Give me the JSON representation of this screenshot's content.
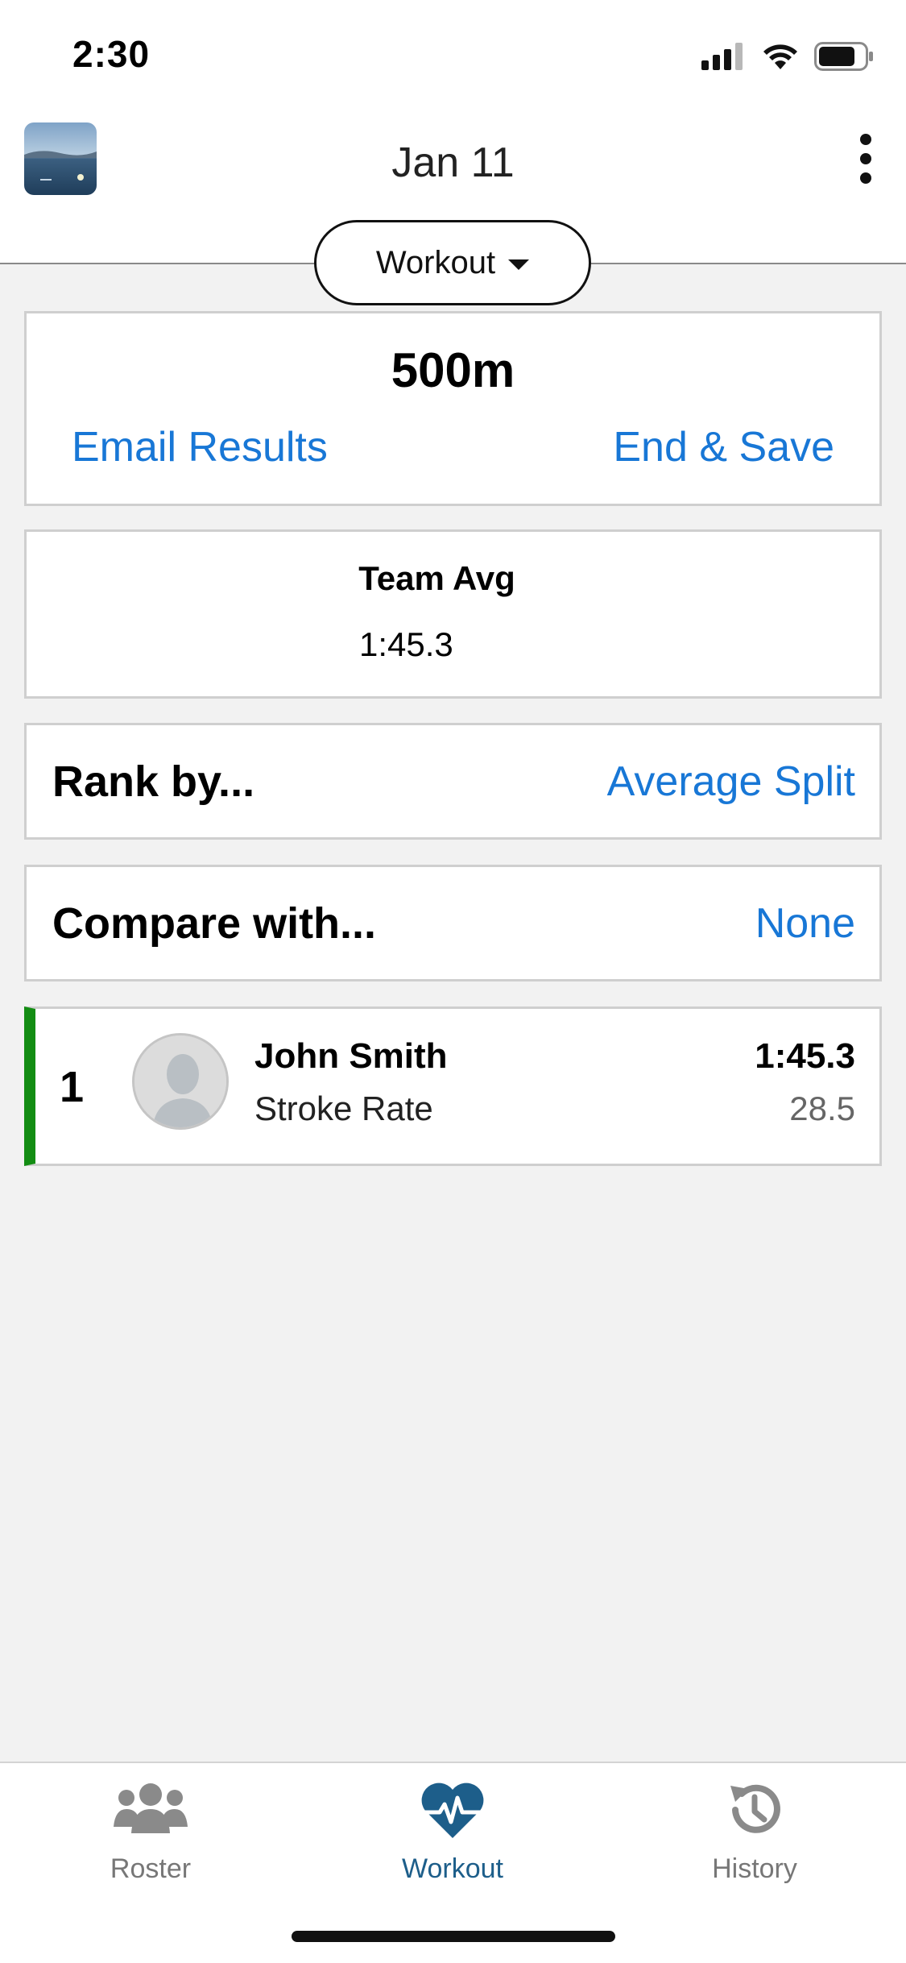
{
  "status_bar": {
    "time": "2:30",
    "icons": [
      "signal-icon",
      "wifi-icon",
      "battery-icon"
    ]
  },
  "header": {
    "title": "Jan 11",
    "mode_label": "Workout"
  },
  "summary": {
    "distance": "500m",
    "email_label": "Email Results",
    "end_save_label": "End & Save"
  },
  "team": {
    "label": "Team Avg",
    "value": "1:45.3"
  },
  "rank_by": {
    "label": "Rank by...",
    "value": "Average Split"
  },
  "compare_with": {
    "label": "Compare with...",
    "value": "None"
  },
  "athletes": [
    {
      "rank": "1",
      "name": "John Smith",
      "metric_label": "Stroke Rate",
      "split": "1:45.3",
      "metric_value": "28.5"
    }
  ],
  "tabs": [
    {
      "label": "Roster",
      "icon": "users-icon"
    },
    {
      "label": "Workout",
      "icon": "heart-pulse-icon",
      "active": true
    },
    {
      "label": "History",
      "icon": "history-icon"
    }
  ],
  "colors": {
    "accent": "#1877d6",
    "active_tab": "#1d5e8a",
    "rank_bar": "#138d13",
    "background": "#f2f2f2"
  }
}
